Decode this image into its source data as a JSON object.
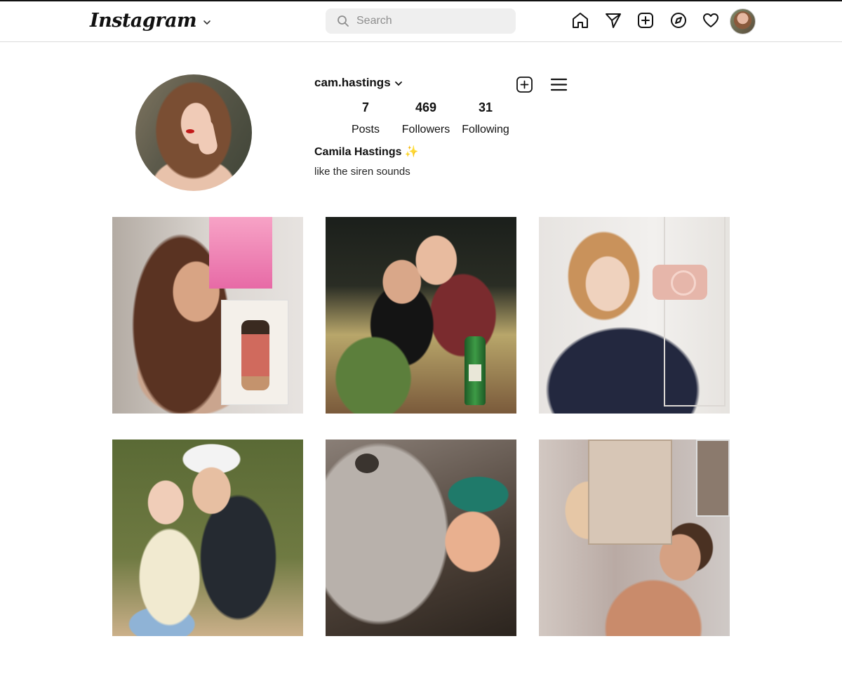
{
  "nav": {
    "logo": "Instagram",
    "search_placeholder": "Search",
    "icons": [
      "home-icon",
      "direct-message-icon",
      "new-post-icon",
      "explore-icon",
      "activity-heart-icon",
      "profile-avatar"
    ]
  },
  "profile": {
    "username": "cam.hastings",
    "stats": {
      "posts_count": "7",
      "posts_label": "Posts",
      "followers_count": "469",
      "followers_label": "Followers",
      "following_count": "31",
      "following_label": "Following"
    },
    "full_name": "Camila Hastings ✨",
    "bio": "like the siren sounds"
  },
  "posts": [
    {
      "index": 1
    },
    {
      "index": 2
    },
    {
      "index": 3
    },
    {
      "index": 4
    },
    {
      "index": 5
    },
    {
      "index": 6
    }
  ],
  "colors": {
    "border": "#dbdbdb",
    "search_bg": "#efefef",
    "text": "#111111",
    "sparkle": "#f5c542"
  }
}
